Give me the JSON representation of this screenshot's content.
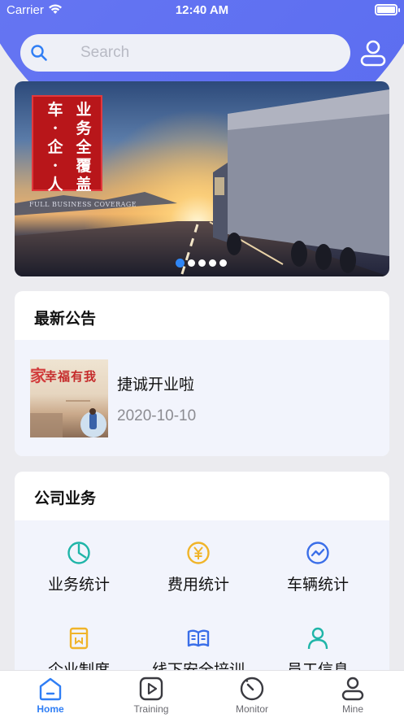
{
  "status_bar": {
    "carrier": "Carrier",
    "time": "12:40 AM"
  },
  "search": {
    "placeholder": "Search"
  },
  "banner": {
    "headline_col1": "车·企·人",
    "headline_col2": "业务全覆盖",
    "subtitle": "FULL BUSINESS COVERAGE",
    "slides": 5,
    "active_slide": 1
  },
  "notice": {
    "title": "最新公告",
    "item": {
      "title": "捷诚开业啦",
      "date": "2020-10-10",
      "thumb_text_a": "家",
      "thumb_text_b": "幸福有我"
    }
  },
  "business": {
    "title": "公司业务",
    "items": [
      {
        "label": "业务统计",
        "icon": "pie-chart-icon",
        "color": "#1fb5a8"
      },
      {
        "label": "费用统计",
        "icon": "yen-icon",
        "color": "#f0b429"
      },
      {
        "label": "车辆统计",
        "icon": "trend-icon",
        "color": "#3a6ee8"
      },
      {
        "label": "企业制度",
        "icon": "document-icon",
        "color": "#f0b429"
      },
      {
        "label": "线下安全培训",
        "icon": "book-icon",
        "color": "#3a6ee8"
      },
      {
        "label": "员工信息",
        "icon": "person-icon",
        "color": "#1fb5a8"
      }
    ]
  },
  "tabs": [
    {
      "label": "Home",
      "icon": "home-icon",
      "active": true
    },
    {
      "label": "Training",
      "icon": "play-icon",
      "active": false
    },
    {
      "label": "Monitor",
      "icon": "gauge-icon",
      "active": false
    },
    {
      "label": "Mine",
      "icon": "user-icon",
      "active": false
    }
  ],
  "colors": {
    "accent": "#2f7ef5",
    "header": "#5f6ff2"
  }
}
